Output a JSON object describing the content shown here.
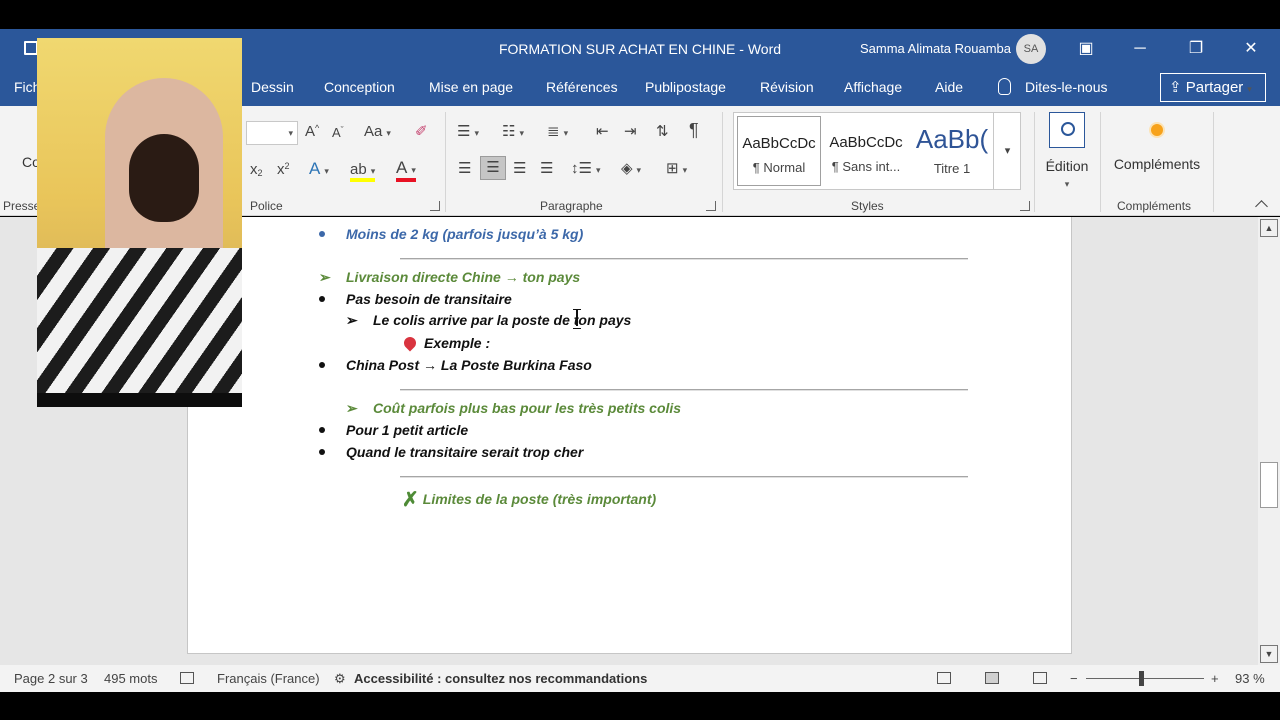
{
  "window": {
    "title": "FORMATION SUR ACHAT EN CHINE  -  Word",
    "user_name": "Samma Alimata Rouamba",
    "user_initials": "SA",
    "minimize": "─",
    "restore": "❐",
    "close": "✕"
  },
  "ribbon_tabs": {
    "file": "Fich",
    "draw": "Dessin",
    "design": "Conception",
    "layout": "Mise en page",
    "references": "Références",
    "mailings": "Publipostage",
    "review": "Révision",
    "view": "Affichage",
    "help": "Aide",
    "tell_me": "Dites-le-nous",
    "share": "Partager"
  },
  "ribbon": {
    "clipboard_label": "Presse",
    "clipboard_copy": "Co",
    "font_label": "Police",
    "paragraph_label": "Paragraphe",
    "styles_label": "Styles",
    "addins_label": "Compléments",
    "font_grow": "A",
    "font_shrink": "A",
    "change_case": "Aa",
    "subscript": "x",
    "superscript": "x",
    "text_effects": "A",
    "highlight": "ab",
    "font_color": "A",
    "pilcrow": "¶",
    "styles": [
      {
        "preview": "AaBbCcDc",
        "name": "¶ Normal"
      },
      {
        "preview": "AaBbCcDc",
        "name": "¶ Sans int..."
      },
      {
        "preview": "AaBb(",
        "name": "Titre 1"
      }
    ],
    "editing_label": "Édition",
    "addins_button": "Compléments"
  },
  "document": {
    "lines": [
      {
        "marker": "bullet",
        "text": "Moins de 2 kg (parfois jusqu’à 5 kg)",
        "color": "#3c68a9"
      },
      {
        "marker": "arrow",
        "text": "Livraison directe Chine → ton pays",
        "color": "#5b8a3a"
      },
      {
        "marker": "bullet",
        "text": "Pas besoin de transitaire",
        "color": "#111111"
      },
      {
        "marker": "arrow",
        "text": "Le colis arrive par la poste de ton pays",
        "color": "#111111"
      },
      {
        "marker": "pin-icon",
        "text": "Exemple :",
        "color": "#111111"
      },
      {
        "marker": "bullet",
        "text": "China Post → La Poste Burkina Faso",
        "color": "#111111"
      },
      {
        "marker": "arrow",
        "text": "Coût parfois plus bas pour les très petits colis",
        "color": "#5b8a3a"
      },
      {
        "marker": "bullet",
        "text": "Pour 1 petit article",
        "color": "#111111"
      },
      {
        "marker": "bullet",
        "text": "Quand le transitaire serait trop cher",
        "color": "#111111"
      },
      {
        "marker": "cross-icon",
        "text": "Limites de la poste (très important)",
        "color": "#5b8a3a"
      }
    ],
    "bullet_glyph": "●",
    "arrow_glyph": "➢",
    "cross_glyph": "✗"
  },
  "statusbar": {
    "page": "Page 2 sur 3",
    "words": "495 mots",
    "language": "Français (France)",
    "accessibility": "Accessibilité : consultez nos recommandations",
    "zoom_minus": "−",
    "zoom_plus": "+",
    "zoom_level": "93 %",
    "zoom_fraction": 0.93
  },
  "colors": {
    "brand": "#2b579a",
    "blue_text": "#3c68a9",
    "green_text": "#5b8a3a"
  }
}
